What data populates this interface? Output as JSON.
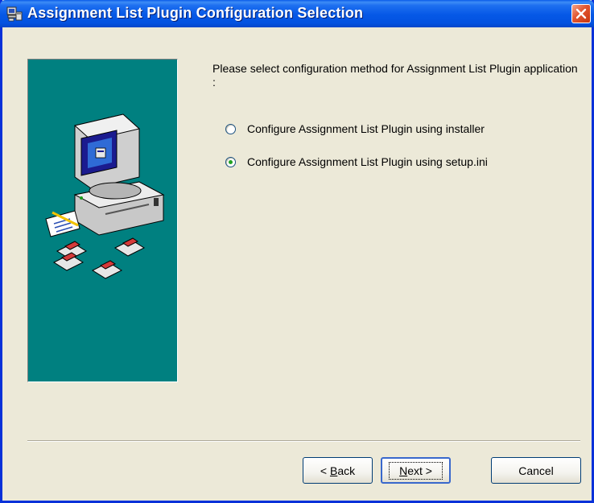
{
  "window": {
    "title": "Assignment List Plugin Configuration Selection"
  },
  "content": {
    "prompt": "Please select configuration method for  Assignment List Plugin application :",
    "options": [
      {
        "label": "Configure Assignment List Plugin using installer",
        "selected": false
      },
      {
        "label": "Configure Assignment List Plugin using setup.ini",
        "selected": true
      }
    ]
  },
  "buttons": {
    "back_prefix": "< ",
    "back_accel": "B",
    "back_rest": "ack",
    "next_accel": "N",
    "next_rest": "ext >",
    "cancel": "Cancel"
  },
  "colors": {
    "title_bar": "#0558e6",
    "dialog_bg": "#ece9d8",
    "side_panel": "#008080"
  },
  "icons": {
    "title": "setup-computer-icon",
    "close": "close-icon",
    "panel": "computer-with-disks-illustration"
  }
}
